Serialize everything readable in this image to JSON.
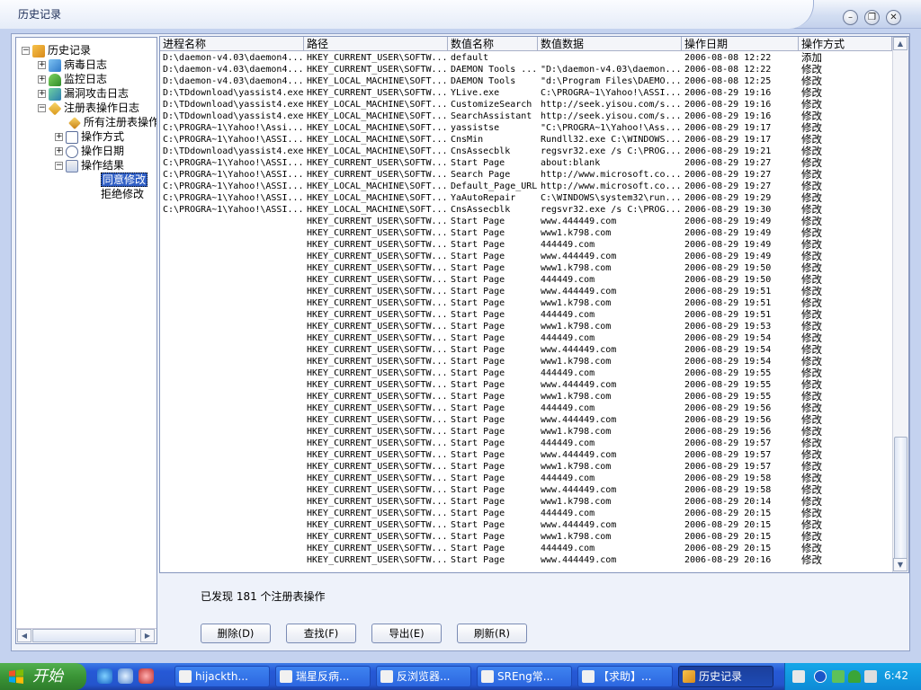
{
  "window": {
    "title": "历史记录"
  },
  "tree": {
    "root": "历史记录",
    "items": [
      {
        "label": "病毒日志"
      },
      {
        "label": "监控日志"
      },
      {
        "label": "漏洞攻击日志"
      },
      {
        "label": "注册表操作日志"
      },
      {
        "label": "所有注册表操作"
      },
      {
        "label": "操作方式"
      },
      {
        "label": "操作日期"
      },
      {
        "label": "操作结果"
      },
      {
        "label": "同意修改"
      },
      {
        "label": "拒绝修改"
      }
    ]
  },
  "grid": {
    "columns": [
      "进程名称",
      "路径",
      "数值名称",
      "数值数据",
      "操作日期",
      "操作方式"
    ],
    "rows": [
      [
        "D:\\daemon-v4.03\\daemon4...",
        "HKEY_CURRENT_USER\\SOFTW...",
        "default",
        "",
        "2006-08-08 12:22",
        "添加"
      ],
      [
        "D:\\daemon-v4.03\\daemon4...",
        "HKEY_CURRENT_USER\\SOFTW...",
        "DAEMON Tools ...",
        "\"D:\\daemon-v4.03\\daemon...",
        "2006-08-08 12:22",
        "修改"
      ],
      [
        "D:\\daemon-v4.03\\daemon4...",
        "HKEY_LOCAL_MACHINE\\SOFT...",
        "DAEMON Tools",
        "\"d:\\Program Files\\DAEMO...",
        "2006-08-08 12:25",
        "修改"
      ],
      [
        "D:\\TDdownload\\yassist4.exe",
        "HKEY_CURRENT_USER\\SOFTW...",
        "YLive.exe",
        "C:\\PROGRA~1\\Yahoo!\\ASSI...",
        "2006-08-29 19:16",
        "修改"
      ],
      [
        "D:\\TDdownload\\yassist4.exe",
        "HKEY_LOCAL_MACHINE\\SOFT...",
        "CustomizeSearch",
        "http://seek.yisou.com/s...",
        "2006-08-29 19:16",
        "修改"
      ],
      [
        "D:\\TDdownload\\yassist4.exe",
        "HKEY_LOCAL_MACHINE\\SOFT...",
        "SearchAssistant",
        "http://seek.yisou.com/s...",
        "2006-08-29 19:16",
        "修改"
      ],
      [
        "C:\\PROGRA~1\\Yahoo!\\Assi...",
        "HKEY_LOCAL_MACHINE\\SOFT...",
        "yassistse",
        "\"C:\\PROGRA~1\\Yahoo!\\Ass...",
        "2006-08-29 19:17",
        "修改"
      ],
      [
        "C:\\PROGRA~1\\Yahoo!\\ASSI...",
        "HKEY_LOCAL_MACHINE\\SOFT...",
        "CnsMin",
        "Rundll32.exe C:\\WINDOWS...",
        "2006-08-29 19:17",
        "修改"
      ],
      [
        "D:\\TDdownload\\yassist4.exe",
        "HKEY_LOCAL_MACHINE\\SOFT...",
        "CnsAssecblk",
        "regsvr32.exe /s C:\\PROG...",
        "2006-08-29 19:21",
        "修改"
      ],
      [
        "C:\\PROGRA~1\\Yahoo!\\ASSI...",
        "HKEY_CURRENT_USER\\SOFTW...",
        "Start Page",
        "about:blank",
        "2006-08-29 19:27",
        "修改"
      ],
      [
        "C:\\PROGRA~1\\Yahoo!\\ASSI...",
        "HKEY_CURRENT_USER\\SOFTW...",
        "Search Page",
        "http://www.microsoft.co...",
        "2006-08-29 19:27",
        "修改"
      ],
      [
        "C:\\PROGRA~1\\Yahoo!\\ASSI...",
        "HKEY_LOCAL_MACHINE\\SOFT...",
        "Default_Page_URL",
        "http://www.microsoft.co...",
        "2006-08-29 19:27",
        "修改"
      ],
      [
        "C:\\PROGRA~1\\Yahoo!\\ASSI...",
        "HKEY_LOCAL_MACHINE\\SOFT...",
        " YaAutoRepair",
        "C:\\WINDOWS\\system32\\run...",
        "2006-08-29 19:29",
        "修改"
      ],
      [
        "C:\\PROGRA~1\\Yahoo!\\ASSI...",
        "HKEY_LOCAL_MACHINE\\SOFT...",
        "CnsAssecblk",
        "regsvr32.exe /s C:\\PROG...",
        "2006-08-29 19:30",
        "修改"
      ],
      [
        "",
        "HKEY_CURRENT_USER\\SOFTW...",
        "Start Page",
        "www.444449.com",
        "2006-08-29 19:49",
        "修改"
      ],
      [
        "",
        "HKEY_CURRENT_USER\\SOFTW...",
        "Start Page",
        "www1.k798.com",
        "2006-08-29 19:49",
        "修改"
      ],
      [
        "",
        "HKEY_CURRENT_USER\\SOFTW...",
        "Start Page",
        "444449.com",
        "2006-08-29 19:49",
        "修改"
      ],
      [
        "",
        "HKEY_CURRENT_USER\\SOFTW...",
        "Start Page",
        "www.444449.com",
        "2006-08-29 19:49",
        "修改"
      ],
      [
        "",
        "HKEY_CURRENT_USER\\SOFTW...",
        "Start Page",
        "www1.k798.com",
        "2006-08-29 19:50",
        "修改"
      ],
      [
        "",
        "HKEY_CURRENT_USER\\SOFTW...",
        "Start Page",
        "444449.com",
        "2006-08-29 19:50",
        "修改"
      ],
      [
        "",
        "HKEY_CURRENT_USER\\SOFTW...",
        "Start Page",
        "www.444449.com",
        "2006-08-29 19:51",
        "修改"
      ],
      [
        "",
        "HKEY_CURRENT_USER\\SOFTW...",
        "Start Page",
        "www1.k798.com",
        "2006-08-29 19:51",
        "修改"
      ],
      [
        "",
        "HKEY_CURRENT_USER\\SOFTW...",
        "Start Page",
        "444449.com",
        "2006-08-29 19:51",
        "修改"
      ],
      [
        "",
        "HKEY_CURRENT_USER\\SOFTW...",
        "Start Page",
        "www1.k798.com",
        "2006-08-29 19:53",
        "修改"
      ],
      [
        "",
        "HKEY_CURRENT_USER\\SOFTW...",
        "Start Page",
        "444449.com",
        "2006-08-29 19:54",
        "修改"
      ],
      [
        "",
        "HKEY_CURRENT_USER\\SOFTW...",
        "Start Page",
        "www.444449.com",
        "2006-08-29 19:54",
        "修改"
      ],
      [
        "",
        "HKEY_CURRENT_USER\\SOFTW...",
        "Start Page",
        "www1.k798.com",
        "2006-08-29 19:54",
        "修改"
      ],
      [
        "",
        "HKEY_CURRENT_USER\\SOFTW...",
        "Start Page",
        "444449.com",
        "2006-08-29 19:55",
        "修改"
      ],
      [
        "",
        "HKEY_CURRENT_USER\\SOFTW...",
        "Start Page",
        "www.444449.com",
        "2006-08-29 19:55",
        "修改"
      ],
      [
        "",
        "HKEY_CURRENT_USER\\SOFTW...",
        "Start Page",
        "www1.k798.com",
        "2006-08-29 19:55",
        "修改"
      ],
      [
        "",
        "HKEY_CURRENT_USER\\SOFTW...",
        "Start Page",
        "444449.com",
        "2006-08-29 19:56",
        "修改"
      ],
      [
        "",
        "HKEY_CURRENT_USER\\SOFTW...",
        "Start Page",
        "www.444449.com",
        "2006-08-29 19:56",
        "修改"
      ],
      [
        "",
        "HKEY_CURRENT_USER\\SOFTW...",
        "Start Page",
        "www1.k798.com",
        "2006-08-29 19:56",
        "修改"
      ],
      [
        "",
        "HKEY_CURRENT_USER\\SOFTW...",
        "Start Page",
        "444449.com",
        "2006-08-29 19:57",
        "修改"
      ],
      [
        "",
        "HKEY_CURRENT_USER\\SOFTW...",
        "Start Page",
        "www.444449.com",
        "2006-08-29 19:57",
        "修改"
      ],
      [
        "",
        "HKEY_CURRENT_USER\\SOFTW...",
        "Start Page",
        "www1.k798.com",
        "2006-08-29 19:57",
        "修改"
      ],
      [
        "",
        "HKEY_CURRENT_USER\\SOFTW...",
        "Start Page",
        "444449.com",
        "2006-08-29 19:58",
        "修改"
      ],
      [
        "",
        "HKEY_CURRENT_USER\\SOFTW...",
        "Start Page",
        "www.444449.com",
        "2006-08-29 19:58",
        "修改"
      ],
      [
        "",
        "HKEY_CURRENT_USER\\SOFTW...",
        "Start Page",
        "www1.k798.com",
        "2006-08-29 20:14",
        "修改"
      ],
      [
        "",
        "HKEY_CURRENT_USER\\SOFTW...",
        "Start Page",
        "444449.com",
        "2006-08-29 20:15",
        "修改"
      ],
      [
        "",
        "HKEY_CURRENT_USER\\SOFTW...",
        "Start Page",
        "www.444449.com",
        "2006-08-29 20:15",
        "修改"
      ],
      [
        "",
        "HKEY_CURRENT_USER\\SOFTW...",
        "Start Page",
        "www1.k798.com",
        "2006-08-29 20:15",
        "修改"
      ],
      [
        "",
        "HKEY_CURRENT_USER\\SOFTW...",
        "Start Page",
        "444449.com",
        "2006-08-29 20:15",
        "修改"
      ],
      [
        "",
        "HKEY_CURRENT_USER\\SOFTW...",
        "Start Page",
        "www.444449.com",
        "2006-08-29 20:16",
        "修改"
      ]
    ]
  },
  "status": {
    "text": "已发现 181 个注册表操作"
  },
  "actions": {
    "delete": "删除(D)",
    "find": "查找(F)",
    "export": "导出(E)",
    "refresh": "刷新(R)"
  },
  "taskbar": {
    "start": "开始",
    "tasks": [
      "hijackth...",
      "瑞星反病...",
      "反浏览器...",
      "SREng常...",
      "【求助】...",
      "历史记录"
    ],
    "clock": "6:42"
  },
  "colors": {
    "selection": "#3160c6",
    "taskbar": "#2455cd",
    "start": "#3a9436"
  }
}
